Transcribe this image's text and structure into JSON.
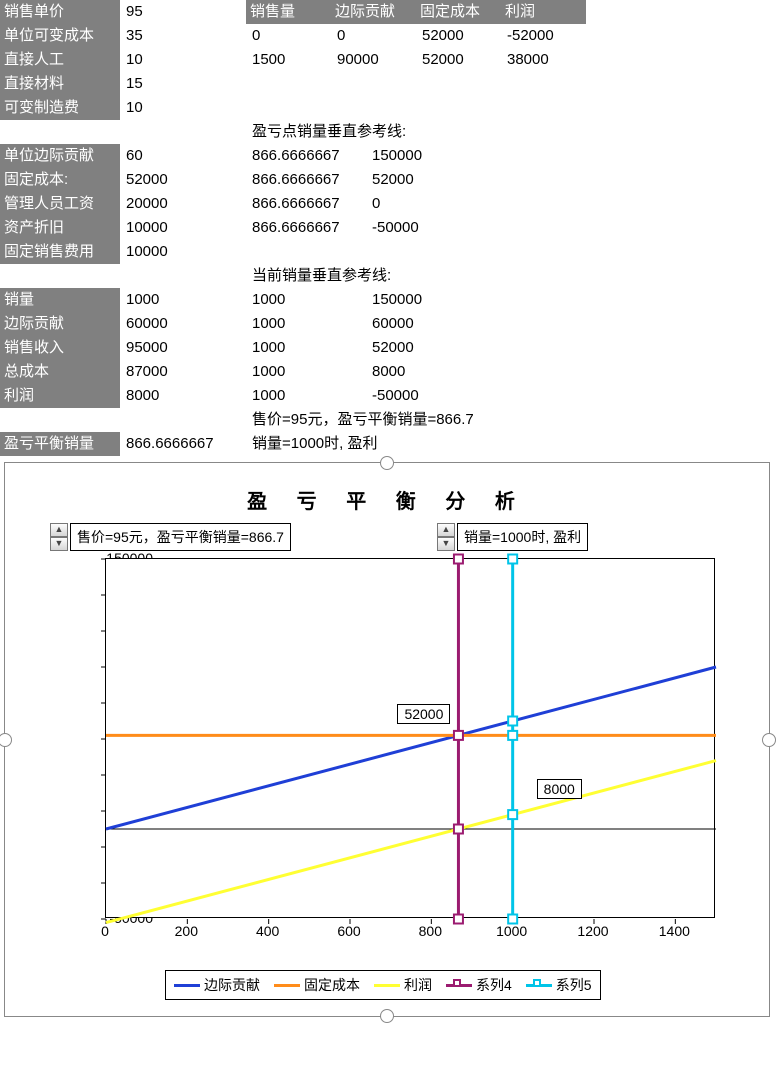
{
  "left": {
    "labels": [
      "销售单价",
      "单位可变成本",
      "直接人工",
      "直接材料",
      "可变制造费",
      "",
      "单位边际贡献",
      "固定成本:",
      "管理人员工资",
      "资产折旧",
      "固定销售费用",
      "",
      "销量",
      "边际贡献",
      "销售收入",
      "总成本",
      "利润",
      "",
      "盈亏平衡销量"
    ],
    "values": [
      "95",
      "35",
      "10",
      "15",
      "10",
      "",
      "60",
      "52000",
      "20000",
      "10000",
      "10000",
      "",
      "1000",
      "60000",
      "95000",
      "87000",
      "8000",
      "",
      "866.6666667"
    ]
  },
  "right": {
    "headers": [
      "销售量",
      "边际贡献",
      "固定成本",
      "利润"
    ],
    "rows": [
      [
        "0",
        "0",
        "52000",
        "-52000"
      ],
      [
        "1500",
        "90000",
        "52000",
        "38000"
      ]
    ],
    "section2_title": "盈亏点销量垂直参考线:",
    "section2": [
      [
        "866.6666667",
        "150000"
      ],
      [
        "866.6666667",
        "52000"
      ],
      [
        "866.6666667",
        "0"
      ],
      [
        "866.6666667",
        "-50000"
      ]
    ],
    "section3_title": "当前销量垂直参考线:",
    "section3": [
      [
        "1000",
        "150000"
      ],
      [
        "1000",
        "60000"
      ],
      [
        "1000",
        "52000"
      ],
      [
        "1000",
        "8000"
      ],
      [
        "1000",
        "-50000"
      ]
    ],
    "footer1": "售价=95元，盈亏平衡销量=866.7",
    "footer2": "销量=1000时, 盈利"
  },
  "chart_data": {
    "type": "line",
    "title": "盈 亏 平 衡 分 析",
    "xlabel": "",
    "ylabel": "",
    "xlim": [
      0,
      1500
    ],
    "ylim": [
      -50000,
      150000
    ],
    "xticks": [
      0,
      200,
      400,
      600,
      800,
      1000,
      1200,
      1400
    ],
    "yticks": [
      -50000,
      -30000,
      -10000,
      10000,
      30000,
      50000,
      70000,
      90000,
      110000,
      130000,
      150000
    ],
    "axis_zero_y": 0,
    "series": [
      {
        "name": "边际贡献",
        "color": "#1f3fd6",
        "x": [
          0,
          1500
        ],
        "y": [
          0,
          90000
        ]
      },
      {
        "name": "固定成本",
        "color": "#ff8c1a",
        "x": [
          0,
          1500
        ],
        "y": [
          52000,
          52000
        ]
      },
      {
        "name": "利润",
        "color": "#ffff33",
        "x": [
          0,
          1500
        ],
        "y": [
          -52000,
          38000
        ]
      },
      {
        "name": "系列4",
        "color": "#9b1b70",
        "marker": true,
        "x": [
          866.6666667,
          866.6666667,
          866.6666667,
          866.6666667
        ],
        "y": [
          150000,
          52000,
          0,
          -50000
        ]
      },
      {
        "name": "系列5",
        "color": "#00c4e8",
        "marker": true,
        "x": [
          1000,
          1000,
          1000,
          1000,
          1000
        ],
        "y": [
          150000,
          60000,
          52000,
          8000,
          -50000
        ]
      }
    ],
    "annotations": [
      {
        "text": "52000",
        "x": 866.6666667,
        "y": 52000,
        "dx": -60,
        "dy": -30
      },
      {
        "text": "8000",
        "x": 1000,
        "y": 8000,
        "dx": 25,
        "dy": -35
      }
    ],
    "captions": [
      {
        "text": "售价=95元，盈亏平衡销量=866.7",
        "spinner": true,
        "left": 65
      },
      {
        "text": "销量=1000时, 盈利",
        "spinner": true,
        "left": 452
      }
    ],
    "legend": [
      "边际贡献",
      "固定成本",
      "利润",
      "系列4",
      "系列5"
    ]
  }
}
